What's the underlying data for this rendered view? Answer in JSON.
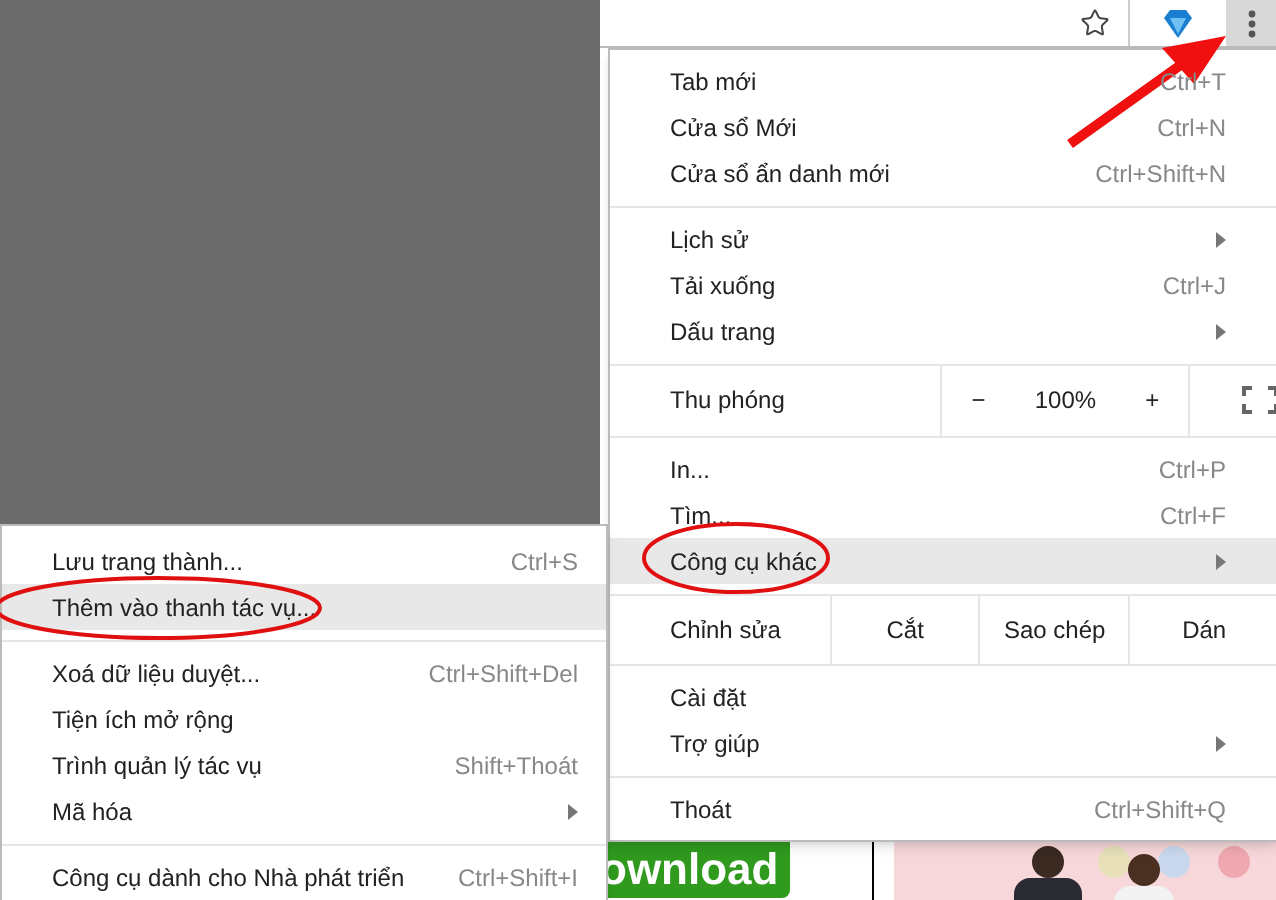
{
  "toolbar": {
    "menu_button": {
      "pressed": true
    }
  },
  "menu": [
    {
      "kind": "item",
      "label": "Tab mới",
      "shortcut": "Ctrl+T",
      "has_submenu": false,
      "selected": false
    },
    {
      "kind": "item",
      "label": "Cửa sổ Mới",
      "shortcut": "Ctrl+N",
      "has_submenu": false,
      "selected": false
    },
    {
      "kind": "item",
      "label": "Cửa sổ ẩn danh mới",
      "shortcut": "Ctrl+Shift+N",
      "has_submenu": false,
      "selected": false
    },
    {
      "kind": "divider"
    },
    {
      "kind": "item",
      "label": "Lịch sử",
      "has_submenu": true,
      "selected": false
    },
    {
      "kind": "item",
      "label": "Tải xuống",
      "shortcut": "Ctrl+J",
      "has_submenu": false,
      "selected": false
    },
    {
      "kind": "item",
      "label": "Dấu trang",
      "has_submenu": true,
      "selected": false
    },
    {
      "kind": "divider"
    },
    {
      "kind": "zoom",
      "label": "Thu phóng",
      "minus": "−",
      "value": "100%",
      "plus": "+"
    },
    {
      "kind": "divider"
    },
    {
      "kind": "item",
      "label": "In...",
      "shortcut": "Ctrl+P",
      "has_submenu": false,
      "selected": false
    },
    {
      "kind": "item",
      "label": "Tìm...",
      "shortcut": "Ctrl+F",
      "has_submenu": false,
      "selected": false
    },
    {
      "kind": "item",
      "label": "Công cụ khác",
      "has_submenu": true,
      "selected": true
    },
    {
      "kind": "divider"
    },
    {
      "kind": "edit",
      "label": "Chỉnh sửa",
      "buttons": [
        "Cắt",
        "Sao chép",
        "Dán"
      ]
    },
    {
      "kind": "divider"
    },
    {
      "kind": "item",
      "label": "Cài đặt",
      "has_submenu": false,
      "selected": false
    },
    {
      "kind": "item",
      "label": "Trợ giúp",
      "has_submenu": true,
      "selected": false
    },
    {
      "kind": "divider"
    },
    {
      "kind": "item",
      "label": "Thoát",
      "shortcut": "Ctrl+Shift+Q",
      "has_submenu": false,
      "selected": false
    }
  ],
  "submenu": [
    {
      "kind": "item",
      "label": "Lưu trang thành...",
      "shortcut": "Ctrl+S",
      "has_submenu": false,
      "selected": false
    },
    {
      "kind": "item",
      "label": "Thêm vào thanh tác vụ...",
      "has_submenu": false,
      "selected": true
    },
    {
      "kind": "divider"
    },
    {
      "kind": "item",
      "label": "Xoá dữ liệu duyệt...",
      "shortcut": "Ctrl+Shift+Del",
      "has_submenu": false,
      "selected": false
    },
    {
      "kind": "item",
      "label": "Tiện ích mở rộng",
      "has_submenu": false,
      "selected": false
    },
    {
      "kind": "item",
      "label": "Trình quản lý tác vụ",
      "shortcut": "Shift+Thoát",
      "has_submenu": false,
      "selected": false
    },
    {
      "kind": "item",
      "label": "Mã hóa",
      "has_submenu": true,
      "selected": false
    },
    {
      "kind": "divider"
    },
    {
      "kind": "item",
      "label": "Công cụ dành cho Nhà phát triển",
      "shortcut": "Ctrl+Shift+I",
      "has_submenu": false,
      "selected": false
    }
  ],
  "page": {
    "download_button": "ownload"
  }
}
